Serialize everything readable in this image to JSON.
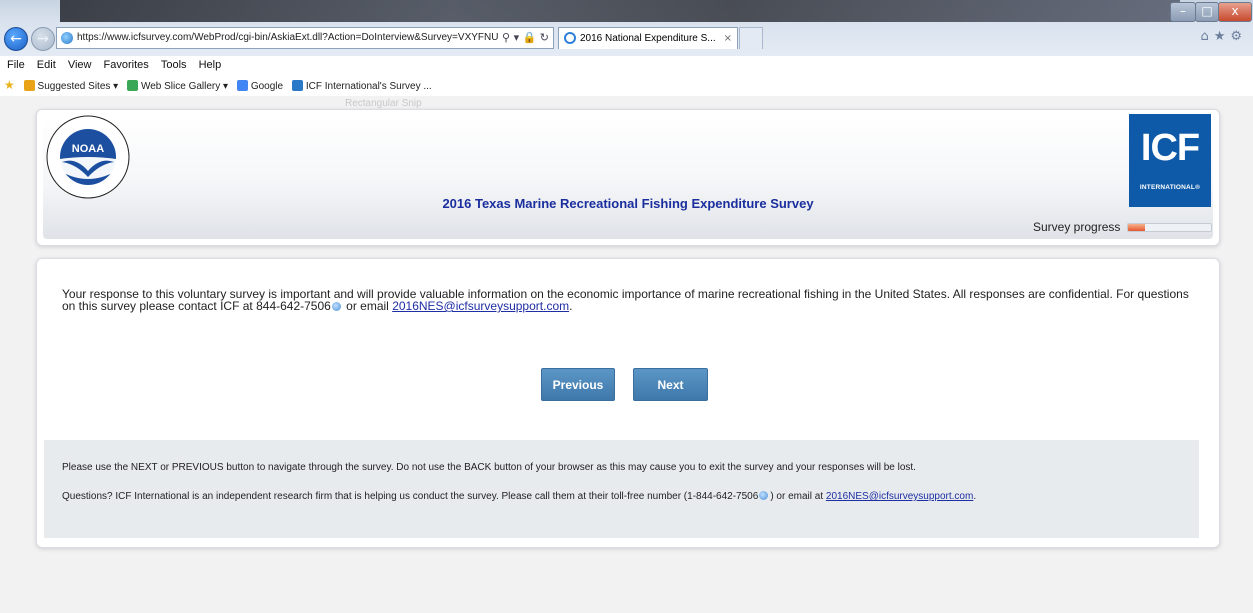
{
  "browser": {
    "url": "https://www.icfsurvey.com/WebProd/cgi-bin/AskiaExt.dll?Action=DoInterview&Survey=VXYFNUWNDI",
    "address_tools": "⚲ ▾ 🔒 ↻",
    "tab_title": "2016 National Expenditure S...",
    "tab_close": "×",
    "right_icons": "⌂★⚙",
    "window_controls": {
      "minimize": "–",
      "maximize": "□",
      "close": "x"
    },
    "menu": [
      "File",
      "Edit",
      "View",
      "Favorites",
      "Tools",
      "Help"
    ],
    "favorites": [
      "Suggested Sites ▾",
      "Web Slice Gallery ▾",
      "Google",
      "ICF International's Survey ..."
    ],
    "snip_ghost": "Rectangular Snip",
    "icon_colors": {
      "suggested": "#e8a317",
      "webslice": "#3aa757",
      "google": "#4285f4",
      "icf": "#2a78c8"
    }
  },
  "header": {
    "left_logo": "NOAA",
    "right_logo": {
      "letters": "ICF",
      "sub": "INTERNATIONAL®"
    },
    "title": "2016 Texas Marine Recreational Fishing Expenditure Survey",
    "progress_label": "Survey progress",
    "progress_fraction": 0.2
  },
  "intro": {
    "text": "Your response to this voluntary survey is important and will provide valuable information on the economic importance of marine recreational fishing in the United States. All responses are confidential. For questions on this survey please contact ICF at 844-642-7506",
    "email_prefix": " or email ",
    "email": "2016NES@icfsurveysupport.com",
    "end": "."
  },
  "buttons": {
    "previous": "Previous",
    "next": "Next"
  },
  "footer": {
    "line1": "Please use the NEXT or PREVIOUS button to navigate through the survey. Do not use the BACK button of your browser as this may cause you to exit the survey and your responses will be lost.",
    "line2_pre": "Questions? ICF International is an independent research firm that is helping us conduct the survey. Please call them at their toll-free number (1-844-642-7506",
    "line2_mid": ") or email at ",
    "email": "2016NES@icfsurveysupport.com",
    "end": "."
  },
  "colors": {
    "title": "#1a2e9e",
    "button": "#4a86ba",
    "icf_blue": "#0f5aa8",
    "progress": "#e4582e"
  }
}
